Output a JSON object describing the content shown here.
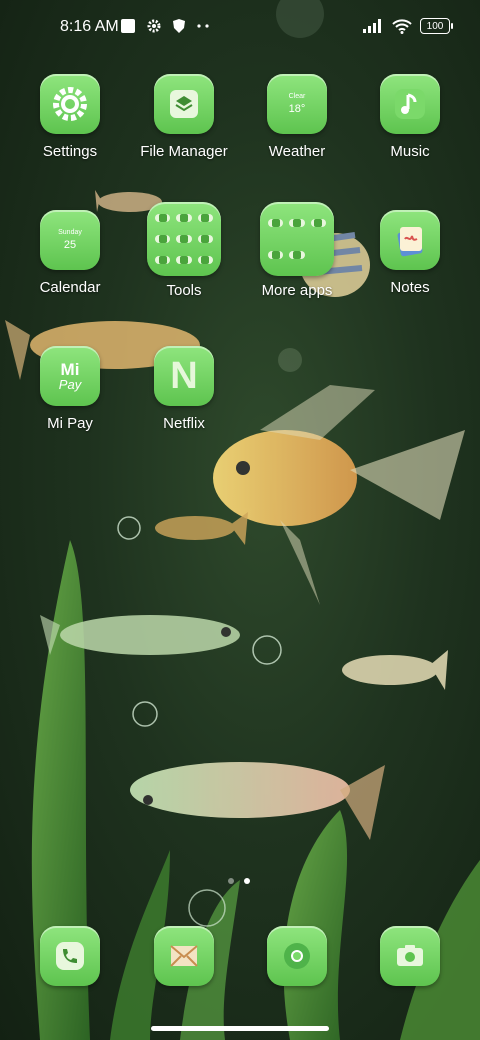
{
  "status_bar": {
    "time": "8:16 AM",
    "left_icons": [
      "gallery-icon",
      "gear-icon",
      "shield-icon",
      "more-icon"
    ],
    "right_icons": [
      "signal-icon",
      "wifi-icon"
    ],
    "battery": "100"
  },
  "apps_row1": [
    {
      "label": "Settings",
      "icon": "gear-icon"
    },
    {
      "label": "File Manager",
      "icon": "layers-icon"
    },
    {
      "label": "Weather",
      "icon": "weather-icon",
      "icon_text_top": "Clear",
      "icon_text_main": "18°"
    },
    {
      "label": "Music",
      "icon": "music-note-icon"
    }
  ],
  "apps_row2": [
    {
      "label": "Calendar",
      "icon": "calendar-icon",
      "icon_text_top": "Sunday",
      "icon_text_main": "25"
    },
    {
      "label": "Tools",
      "icon": "folder-icon"
    },
    {
      "label": "More apps",
      "icon": "folder-icon"
    },
    {
      "label": "Notes",
      "icon": "notes-icon"
    }
  ],
  "apps_row3": [
    {
      "label": "Mi Pay",
      "icon": "mi-pay-icon",
      "icon_text_top": "Mi",
      "icon_text_main": "Pay"
    },
    {
      "label": "Netflix",
      "icon": "netflix-icon",
      "icon_text_main": "N"
    }
  ],
  "dock": [
    "phone-icon",
    "messages-icon",
    "chrome-icon",
    "camera-icon"
  ],
  "page_indicator": {
    "pages": 2,
    "active": 2
  }
}
